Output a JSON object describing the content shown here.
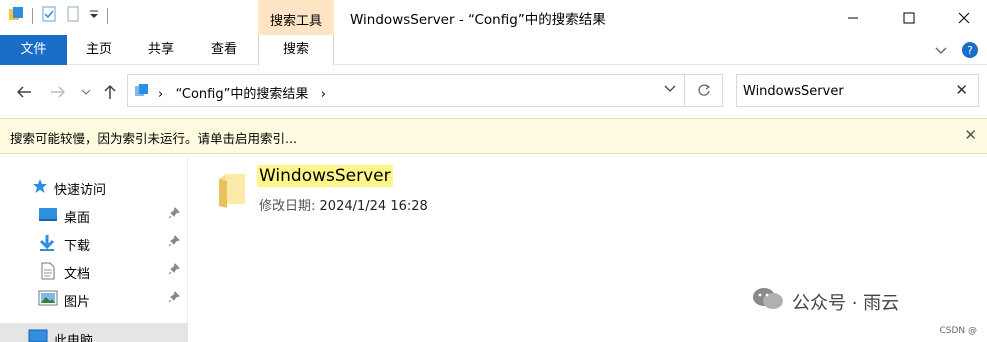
{
  "window": {
    "title": "WindowsServer - “Config”中的搜索结果",
    "context_tab_group": "搜索工具"
  },
  "ribbon": {
    "tabs": [
      "文件",
      "主页",
      "共享",
      "查看",
      "搜索"
    ]
  },
  "address": {
    "path_separator": "›",
    "path_text": "“Config”中的搜索结果",
    "path_chevron": "›"
  },
  "search": {
    "value": "WindowsServer"
  },
  "infobar": {
    "message": "搜索可能较慢，因为索引未运行。请单击启用索引..."
  },
  "nav": {
    "quick_access": "快速访问",
    "items": [
      {
        "label": "桌面",
        "icon": "desktop-icon"
      },
      {
        "label": "下载",
        "icon": "download-icon"
      },
      {
        "label": "文档",
        "icon": "document-icon"
      },
      {
        "label": "图片",
        "icon": "pictures-icon"
      }
    ],
    "this_pc": "此电脑"
  },
  "results": [
    {
      "name": "WindowsServer",
      "meta_label": "修改日期:",
      "meta_value": "2024/1/24 16:28"
    }
  ],
  "watermark": {
    "text": "公众号 · 雨云",
    "csdn": "CSDN @  "
  },
  "colors": {
    "file_tab": "#1a6ec7",
    "context_tab": "#fce4c4",
    "infobar": "#fffbe0",
    "highlight": "#fff68a"
  }
}
